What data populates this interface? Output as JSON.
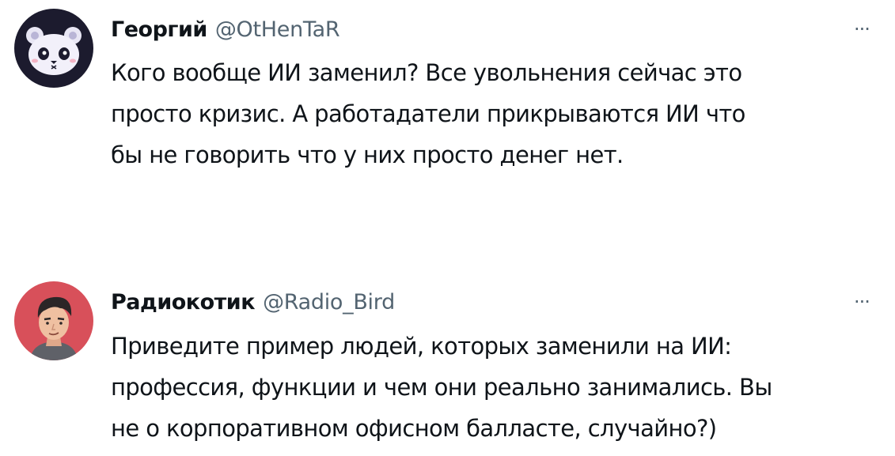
{
  "tweets": [
    {
      "author_name": "Георгий",
      "author_handle": "@OtHenTaR",
      "more_label": "···",
      "avatar_icon": "panda-bear-avatar",
      "text": "Кого вообще ИИ заменил? Все увольнения сейчас это\nпросто кризис. А работадатели прикрываются ИИ что\nбы не говорить что у них просто денег нет."
    },
    {
      "author_name": "Радиокотик",
      "author_handle": "@Radio_Bird",
      "more_label": "···",
      "avatar_icon": "cartoon-man-avatar",
      "text": "Приведите пример людей, которых заменили на ИИ:\nпрофессия, функции и чем они реально занимались. Вы\nне о корпоративном офисном балласте, случайно?)"
    }
  ],
  "colors": {
    "text": "#0f1419",
    "secondary": "#536471",
    "avatar1_bg": "#1c1b2e",
    "avatar2_bg": "#d8505a"
  }
}
